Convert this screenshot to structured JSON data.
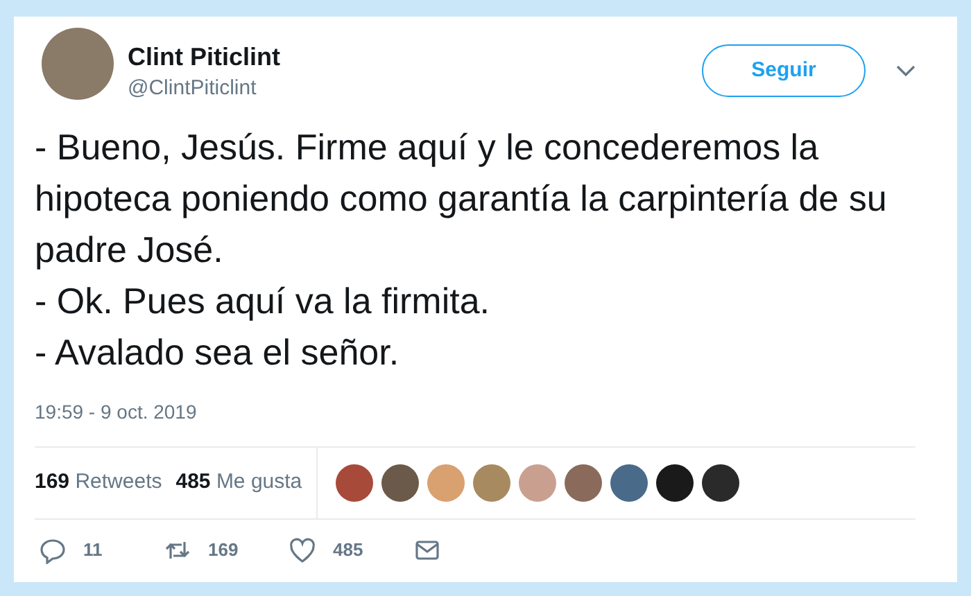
{
  "author": {
    "name": "Clint Piticlint",
    "handle": "@ClintPiticlint"
  },
  "follow_button": "Seguir",
  "tweet_lines": [
    "- Bueno, Jesús. Firme aquí y le concederemos la hipoteca poniendo como garantía la carpintería de su padre José.",
    "- Ok. Pues aquí va la firmita.",
    "- Avalado sea el señor."
  ],
  "timestamp": "19:59 - 9 oct. 2019",
  "stats": [
    {
      "count": "169",
      "label": "Retweets"
    },
    {
      "count": "485",
      "label": "Me gusta"
    }
  ],
  "actions": [
    {
      "kind": "reply",
      "count": "11"
    },
    {
      "kind": "retweet",
      "count": "169"
    },
    {
      "kind": "like",
      "count": "485"
    },
    {
      "kind": "message"
    }
  ]
}
